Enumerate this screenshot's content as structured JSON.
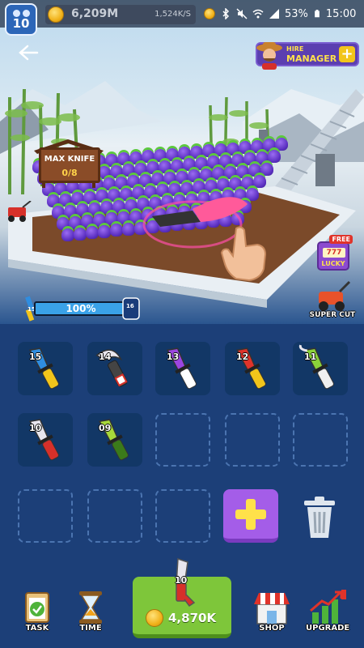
{
  "top_bar": {
    "level": "10",
    "money": "6,209M",
    "money_rate": "1,524K/S"
  },
  "status_bar": {
    "battery": "53%",
    "time": "15:00"
  },
  "hire_manager": {
    "line1": "HIRE",
    "line2": "MANAGER",
    "plus": "+"
  },
  "field_sign": {
    "title": "MAX KNIFE",
    "count": "0/8"
  },
  "free_lucky": {
    "badge": "FREE",
    "reels": "777",
    "label": "LUCKY"
  },
  "progress": {
    "label": "100%",
    "fraction": 1.0,
    "from_level": "15",
    "to_level": "16"
  },
  "super_cut": {
    "label": "SUPER CUT"
  },
  "knives": [
    {
      "level": "15",
      "color": "#2f8de0",
      "accent": "#f2c51b",
      "shape": "straight"
    },
    {
      "level": "14",
      "color": "#e8e6ee",
      "accent": "#d6302a",
      "shape": "karambit"
    },
    {
      "level": "13",
      "color": "#9b45e0",
      "accent": "#ffffff",
      "shape": "straight"
    },
    {
      "level": "12",
      "color": "#e0332a",
      "accent": "#f2c51b",
      "shape": "straight"
    },
    {
      "level": "11",
      "color": "#8ad23a",
      "accent": "#f0f0f0",
      "shape": "hook"
    },
    {
      "level": "10",
      "color": "#e8e6ee",
      "accent": "#d6302a",
      "shape": "straight"
    },
    {
      "level": "09",
      "color": "#a8d83a",
      "accent": "#3b7a1a",
      "shape": "straight"
    }
  ],
  "add_button": {
    "label": "+"
  },
  "buy_button": {
    "price": "4,870K",
    "knife_level": "10"
  },
  "nav": {
    "task": "TASK",
    "time": "TIME",
    "shop": "SHOP",
    "upgrade": "UPGRADE"
  }
}
